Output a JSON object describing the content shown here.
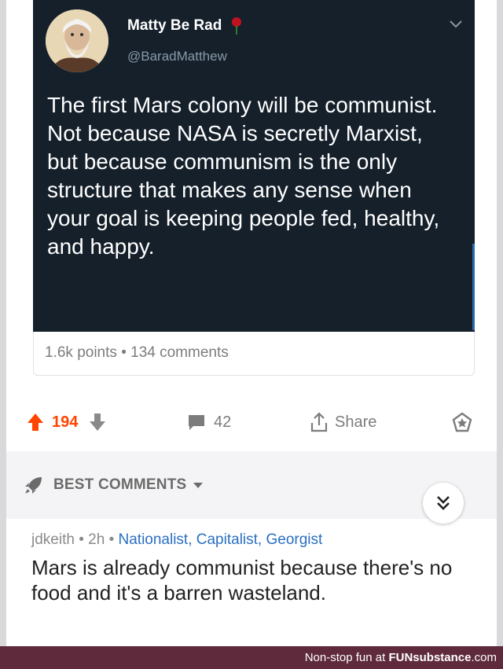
{
  "tweet": {
    "display_name": "Matty Be Rad",
    "handle": "@BaradMatthew",
    "text": "The first Mars colony will be communist. Not because NASA is secretly Marxist, but because communism is the only structure that makes any sense when your goal is keeping people fed, healthy, and happy.",
    "rose_icon": "rose-icon",
    "menu_icon": "chevron-down-icon"
  },
  "post_meta": {
    "points": "1.6k points",
    "separator": "•",
    "comments": "134 comments"
  },
  "actions": {
    "upvotes": "194",
    "comment_count": "42",
    "share_label": "Share",
    "upvote_color": "#ff4500"
  },
  "best_comments": {
    "label": "BEST COMMENTS"
  },
  "comment": {
    "author": "jdkeith",
    "separator": "•",
    "age": "2h",
    "flair": "Nationalist, Capitalist, Georgist",
    "body": "Mars is already communist because there's no food and it's a barren wasteland."
  },
  "footer": {
    "prefix": "Non-stop fun at ",
    "brand": "FUN",
    "brand_rest": "substance",
    "tld": ".com"
  }
}
